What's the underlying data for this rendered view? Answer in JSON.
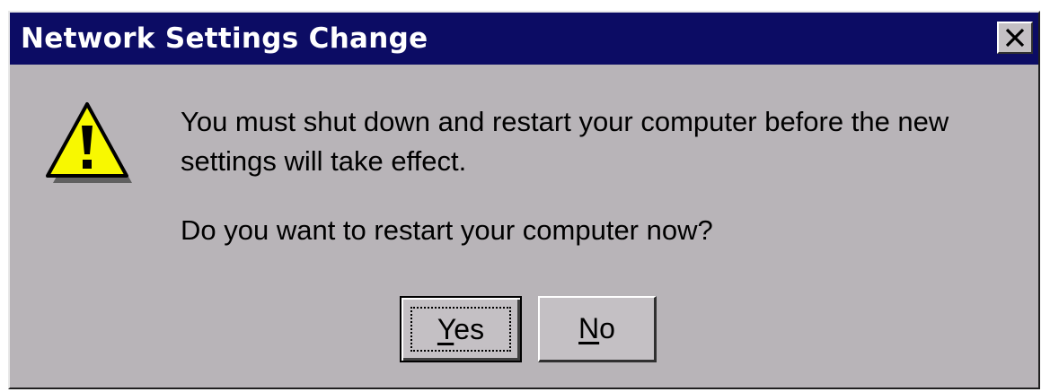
{
  "dialog": {
    "title": "Network Settings Change",
    "message_line1": "You must shut down and restart your computer before the new",
    "message_line2": "settings will take effect.",
    "question": "Do you want to restart your computer now?",
    "icon": "warning-icon",
    "close_icon": "close-icon"
  },
  "buttons": {
    "yes": {
      "mnemonic": "Y",
      "rest": "es"
    },
    "no": {
      "mnemonic": "N",
      "rest": "o"
    }
  },
  "colors": {
    "titlebar": "#0c0c64",
    "dialog_bg": "#b8b4b8",
    "warning_yellow": "#f8f800"
  }
}
